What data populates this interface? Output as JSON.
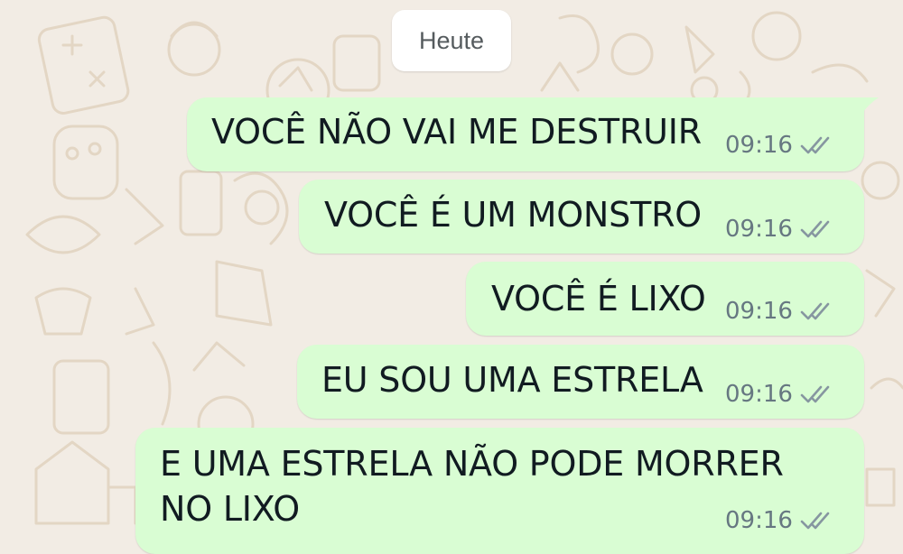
{
  "date_chip": "Heute",
  "messages": [
    {
      "text": "VOCÊ NÃO VAI ME DESTRUIR",
      "time": "09:16",
      "status_icon": "double-check-icon"
    },
    {
      "text": "VOCÊ É UM MONSTRO",
      "time": "09:16",
      "status_icon": "double-check-icon"
    },
    {
      "text": "VOCÊ É LIXO",
      "time": "09:16",
      "status_icon": "double-check-icon"
    },
    {
      "text": "EU SOU UMA ESTRELA",
      "time": "09:16",
      "status_icon": "double-check-icon"
    },
    {
      "text": "E UMA ESTRELA NÃO PODE MORRER\nNO LIXO",
      "time": "09:16",
      "status_icon": "double-check-icon"
    }
  ],
  "colors": {
    "chat_background": "#f2ece4",
    "outgoing_bubble": "#d9fdd3",
    "message_text": "#111b21",
    "meta_text": "#667781",
    "wallpaper_doodle": "#e3d6c4"
  }
}
